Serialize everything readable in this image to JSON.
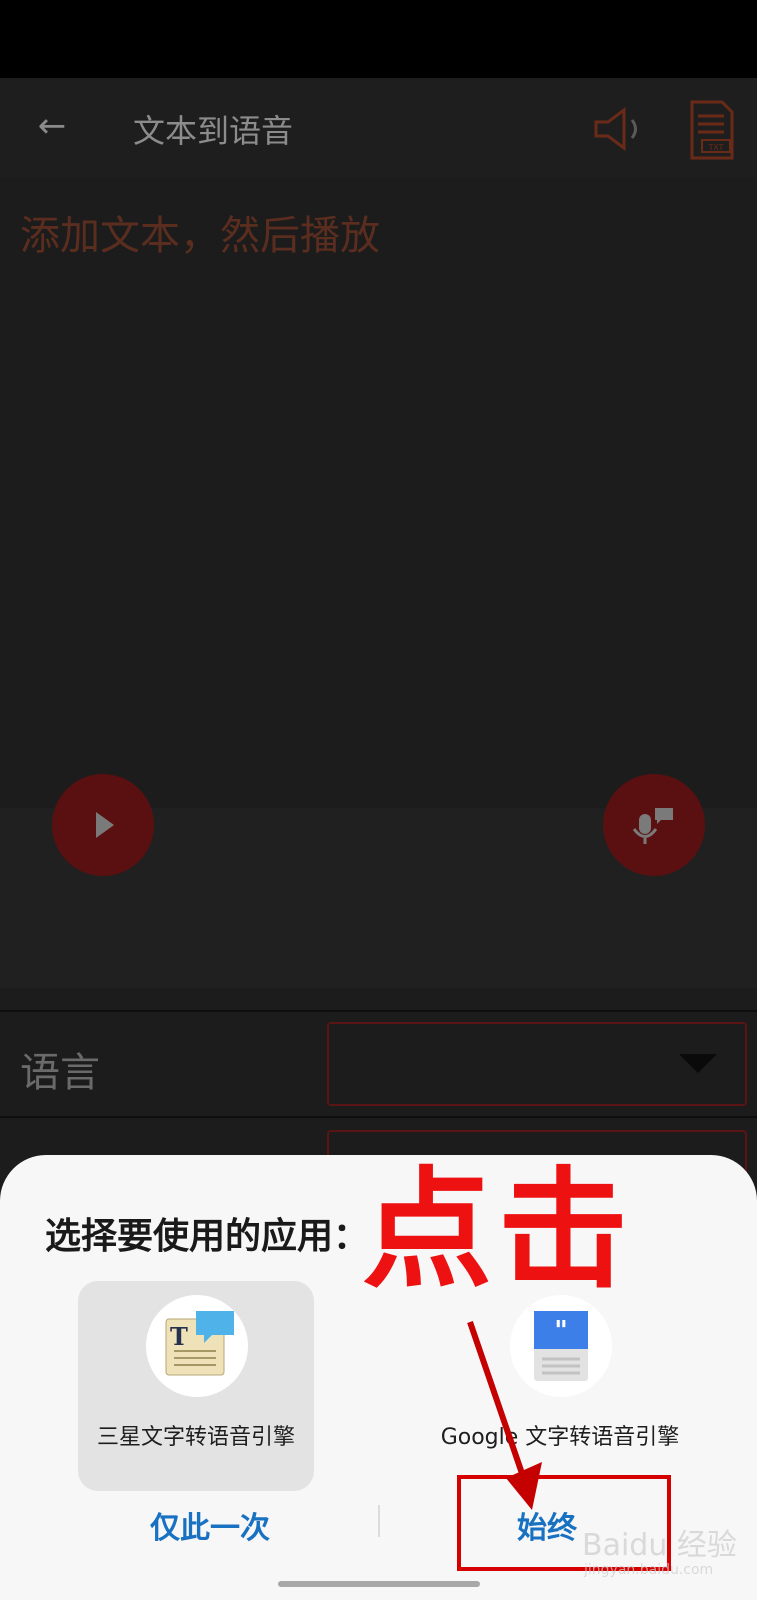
{
  "app": {
    "title": "文本到语音",
    "placeholder": "添加文本，然后播放",
    "language_label": "语言",
    "icons": {
      "back": "back-arrow-icon",
      "speaker": "speaker-icon",
      "txt": "txt-file-icon",
      "play": "play-icon",
      "mic": "mic-icon"
    },
    "colors": {
      "accent": "#5a1010",
      "placeholder": "#5a2d1f"
    }
  },
  "chooser": {
    "title": "选择要使用的应用：",
    "options": [
      {
        "label": "三星文字转语音引擎",
        "icon": "samsung-tts-icon",
        "selected": true
      },
      {
        "label": "Google 文字转语音引擎",
        "icon": "google-tts-icon",
        "selected": false
      }
    ],
    "buttons": {
      "once": "仅此一次",
      "always": "始终"
    },
    "colors": {
      "button": "#1971c2"
    }
  },
  "annotation": {
    "text": "点击",
    "color": "#ee1111"
  },
  "watermark": {
    "text": "Baidu 经验",
    "sub": "jingyan.baidu.com"
  }
}
